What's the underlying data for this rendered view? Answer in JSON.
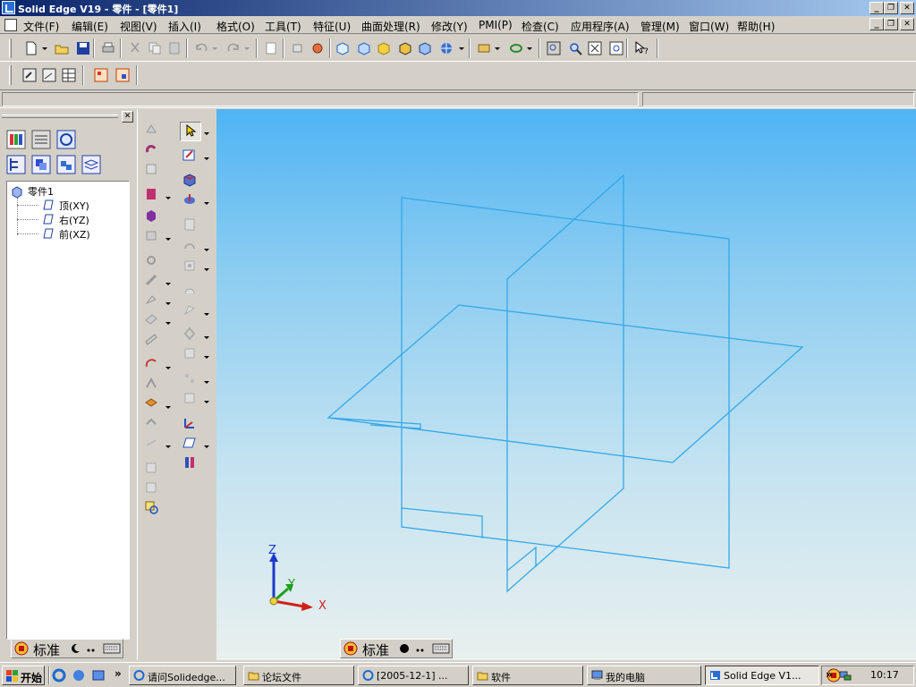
{
  "window": {
    "title": "Solid Edge V19 - 零件 - [零件1]",
    "minimize": "_",
    "restore": "❐",
    "close": "✕"
  },
  "menu": {
    "items": [
      "文件(F)",
      "编辑(E)",
      "视图(V)",
      "插入(I)",
      "格式(O)",
      "工具(T)",
      "特征(U)",
      "曲面处理(R)",
      "修改(Y)",
      "PMI(P)",
      "检查(C)",
      "应用程序(A)",
      "管理(M)",
      "窗口(W)",
      "帮助(H)"
    ]
  },
  "tree": {
    "root": "零件1",
    "items": [
      "顶(XY)",
      "右(YZ)",
      "前(XZ)"
    ]
  },
  "viewport": {
    "triad": {
      "x": "X",
      "y": "Y",
      "z": "Z"
    }
  },
  "ime": {
    "left_label": "标准",
    "right_label": "标准"
  },
  "taskbar": {
    "start": "开始",
    "tasks": [
      "请问Solidedge...",
      "论坛文件",
      "[2005-12-1] ...",
      "软件",
      "我的电脑",
      "Solid Edge V1..."
    ],
    "chevron": "»",
    "clock": "10:17"
  },
  "colors": {
    "title_gradient_start": "#0a246a",
    "title_gradient_end": "#a6caf0",
    "plane_line": "#35a8e8",
    "triad_x": "#d0201a",
    "triad_y": "#1aa01a",
    "triad_z": "#1a3acc"
  }
}
